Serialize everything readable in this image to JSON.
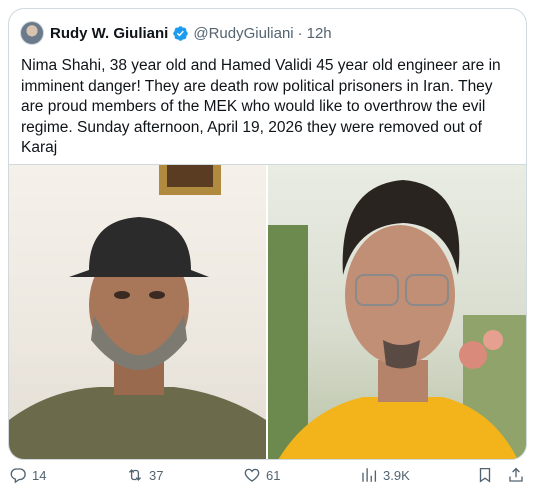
{
  "tweet": {
    "name": "Rudy W. Giuliani",
    "handle": "@RudyGiuliani",
    "separator": "·",
    "time": "12h",
    "text": "Nima Shahi, 38 year old and Hamed Validi 45 year old engineer are in imminent danger! They are death row political prisoners in Iran. They are proud members of the MEK who would like to overthrow the evil regime. Sunday afternoon, April 19, 2026 they were removed out of Karaj"
  },
  "actions": {
    "replies": "14",
    "reposts": "37",
    "likes": "61",
    "views": "3.9K"
  },
  "icons": {
    "verified": "verified-badge-icon",
    "reply": "reply-icon",
    "repost": "repost-icon",
    "like": "heart-icon",
    "views": "views-chart-icon",
    "bookmark": "bookmark-icon",
    "share": "share-icon"
  },
  "colors": {
    "verified_blue": "#1d9bf0",
    "secondary_text": "#536471",
    "border": "#cfd9de"
  }
}
